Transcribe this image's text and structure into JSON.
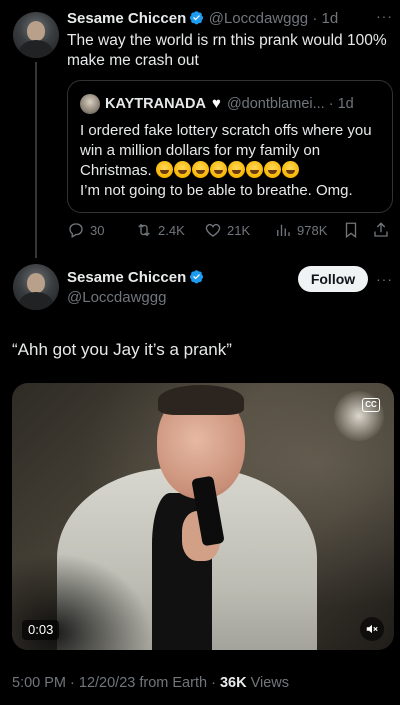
{
  "quoted_tweet": {
    "author_name": "Sesame Chiccen",
    "handle": "@Loccdawggg",
    "time": "1d",
    "text": "The way the world is rn this prank would 100% make me crash out",
    "quote": {
      "author_name": "KAYTRANADA",
      "handle": "@dontblamei...",
      "time": "1d",
      "text_line1": "I ordered fake lottery scratch offs where you win a million dollars for my family on Christmas.",
      "text_line2": "I’m not going to be able to breathe. Omg.",
      "emoji": "😂",
      "emoji_count": 8
    },
    "stats": {
      "replies": "30",
      "reposts": "2.4K",
      "likes": "21K",
      "views": "978K"
    }
  },
  "main_tweet": {
    "author_name": "Sesame Chiccen",
    "handle": "@Loccdawggg",
    "follow_label": "Follow",
    "text": "“Ahh got you Jay it’s a prank”",
    "video": {
      "duration": "0:03"
    },
    "timestamp": "5:00 PM · 12/20/23 from Earth · ",
    "views_count": "36K",
    "views_label": " Views"
  },
  "colors": {
    "background": "#000000",
    "text": "#e7e9ea",
    "muted": "#71767b",
    "verified": "#1d9bf0",
    "border": "#2f3336"
  }
}
